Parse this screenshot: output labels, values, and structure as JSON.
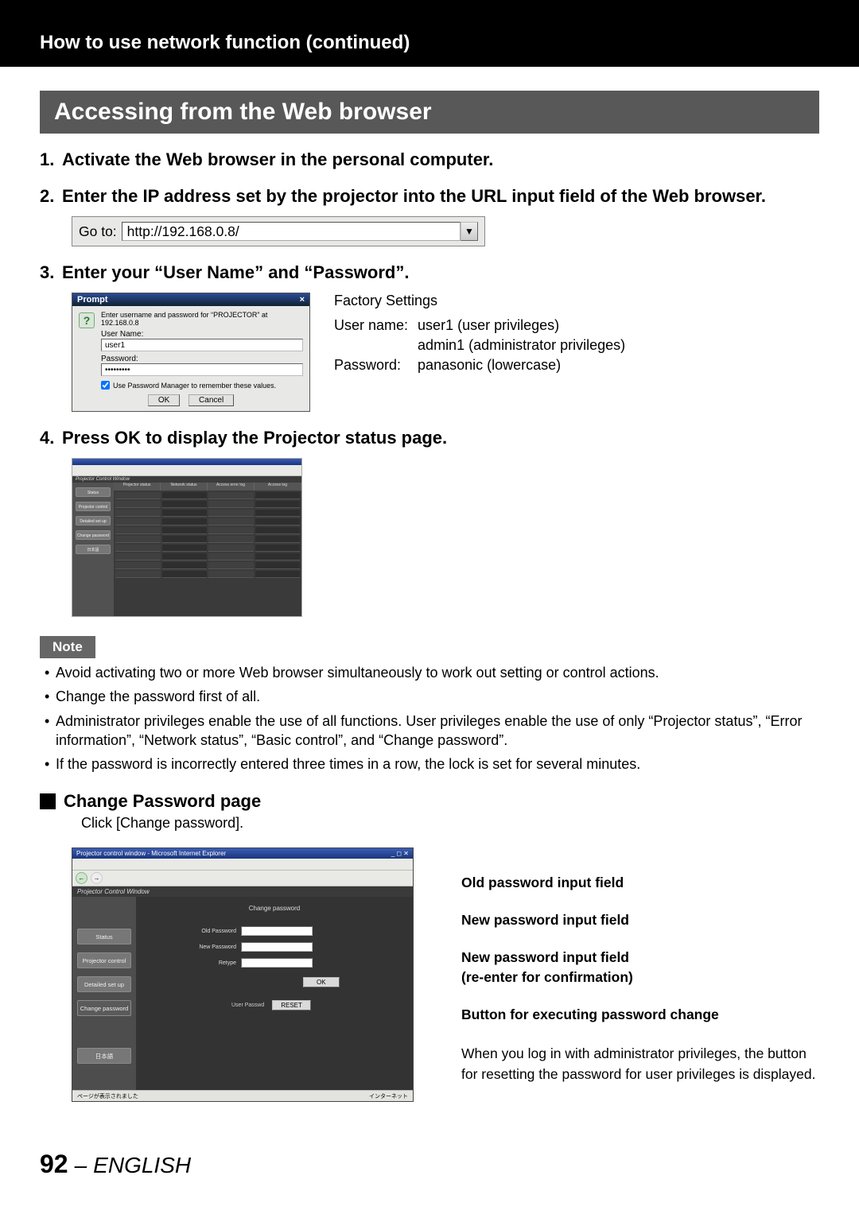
{
  "header": {
    "section_title": "How to use network function (continued)",
    "main_heading": "Accessing from the Web browser"
  },
  "steps": {
    "s1": {
      "num": "1.",
      "text": "Activate the Web browser in the personal computer."
    },
    "s2": {
      "num": "2.",
      "text": "Enter the IP address set by the projector into the URL input field of the Web browser."
    },
    "s3": {
      "num": "3.",
      "text": "Enter your “User Name” and “Password”."
    },
    "s4": {
      "num": "4.",
      "text": "Press OK to display the Projector status page."
    }
  },
  "url": {
    "label": "Go to:",
    "value": "http://192.168.0.8/",
    "drop": "▼"
  },
  "prompt": {
    "title": "Prompt",
    "close": "×",
    "msg": "Enter username and password for “PROJECTOR” at 192.168.0.8",
    "user_label": "User Name:",
    "user_value": "user1",
    "pass_label": "Password:",
    "pass_value": "•••••••••",
    "check_label": "Use Password Manager to remember these values.",
    "ok": "OK",
    "cancel": "Cancel"
  },
  "factory": {
    "head": "Factory Settings",
    "user_label": "User name:",
    "user_val1": "user1 (user privileges)",
    "user_val2": "admin1 (administrator privileges)",
    "pass_label": "Password:",
    "pass_val": "panasonic (lowercase)"
  },
  "status_shot": {
    "win_title": "",
    "sub_title": "Projector Control Window",
    "side": [
      "",
      "Status",
      "Projector control",
      "Detailed set up",
      "Change password",
      "日本語"
    ],
    "tabs": [
      "Projector status",
      "Network status",
      "Access error log",
      "",
      "Access log"
    ]
  },
  "note": {
    "badge": "Note",
    "items": [
      "Avoid activating two or more Web browser simultaneously to work out setting or control actions.",
      "Change the password first of all.",
      "Administrator privileges enable the use of all functions. User privileges enable the use of only “Projector status”, “Error information”, “Network status”, “Basic control”,  and “Change password”.",
      "If the password is incorrectly entered three times in a row, the lock is set for several minutes."
    ]
  },
  "change": {
    "heading": "Change Password page",
    "click": "Click [Change password].",
    "shot": {
      "win_title": "Projector control window - Microsoft Internet Explorer",
      "sub_title": "Projector Control Window",
      "heading": "Change password",
      "side": [
        "Status",
        "Projector control",
        "Detailed set up",
        "Change password",
        "日本語"
      ],
      "old": "Old Password",
      "new": "New Password",
      "re": "Retype",
      "ok": "OK",
      "reset_label": "User Passwd",
      "reset_btn": "RESET",
      "status_left": "ページが表示されました",
      "status_right": "インターネット"
    },
    "labels": {
      "old": "Old password input field",
      "new": "New password input field",
      "re1": "New password input field",
      "re2": "(re-enter for confirmation)",
      "btn": "Button for executing password change",
      "note": "When you log in with administrator privileges, the button for resetting the password for user privileges is displayed."
    }
  },
  "footer": {
    "page": "92",
    "dash": "–",
    "lang": "ENGLISH"
  }
}
